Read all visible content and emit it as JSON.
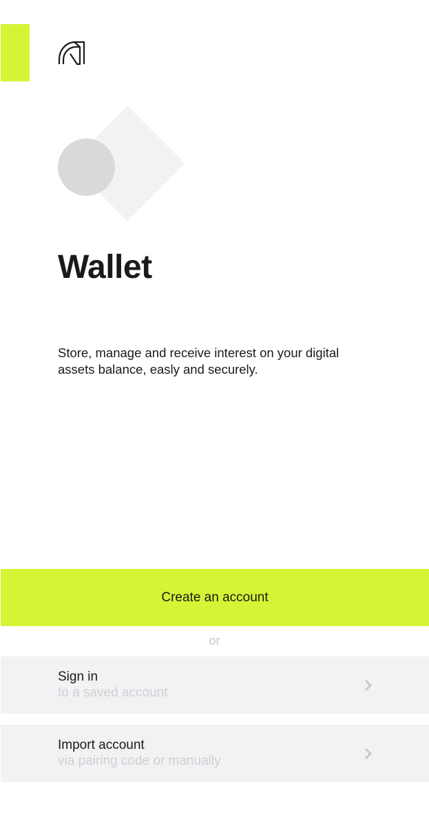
{
  "branding": {
    "accent_color": "#d4f535",
    "logo_icon": "arch-logo-icon"
  },
  "hero": {
    "illustration": "circle-diamond-illustration"
  },
  "page": {
    "title": "Wallet",
    "description": "Store, manage and receive interest on your digital assets balance, easly and securely."
  },
  "actions": {
    "create_account_label": "Create an account",
    "separator": "or",
    "sign_in": {
      "title": "Sign in",
      "subtitle": "to a saved account",
      "icon": "chevron-right-icon"
    },
    "import_account": {
      "title": "Import account",
      "subtitle": "via pairing code or manually",
      "icon": "chevron-right-icon"
    }
  },
  "colors": {
    "row_background": "#f2f2f4",
    "muted_text": "#d0d0d4",
    "text": "#1a1a1a"
  }
}
